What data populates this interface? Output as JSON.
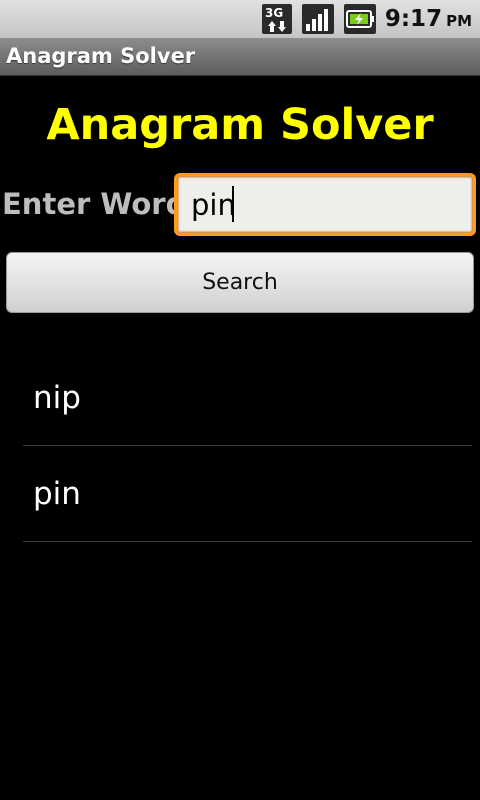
{
  "status_bar": {
    "network_label": "3G",
    "time": "9:17",
    "ampm": "PM",
    "icons": [
      "3g-data-icon",
      "signal-strength-icon",
      "battery-charging-icon"
    ]
  },
  "title_bar": {
    "title": "Anagram Solver"
  },
  "main": {
    "heading": "Anagram Solver",
    "enter_label": "Enter Word:",
    "input_value": "pin",
    "search_label": "Search",
    "results": [
      "nip",
      "pin"
    ]
  },
  "colors": {
    "heading": "#ffff00",
    "label": "#bdbdbd",
    "input_focus_border": "#ff9a1a",
    "background": "#000000"
  }
}
